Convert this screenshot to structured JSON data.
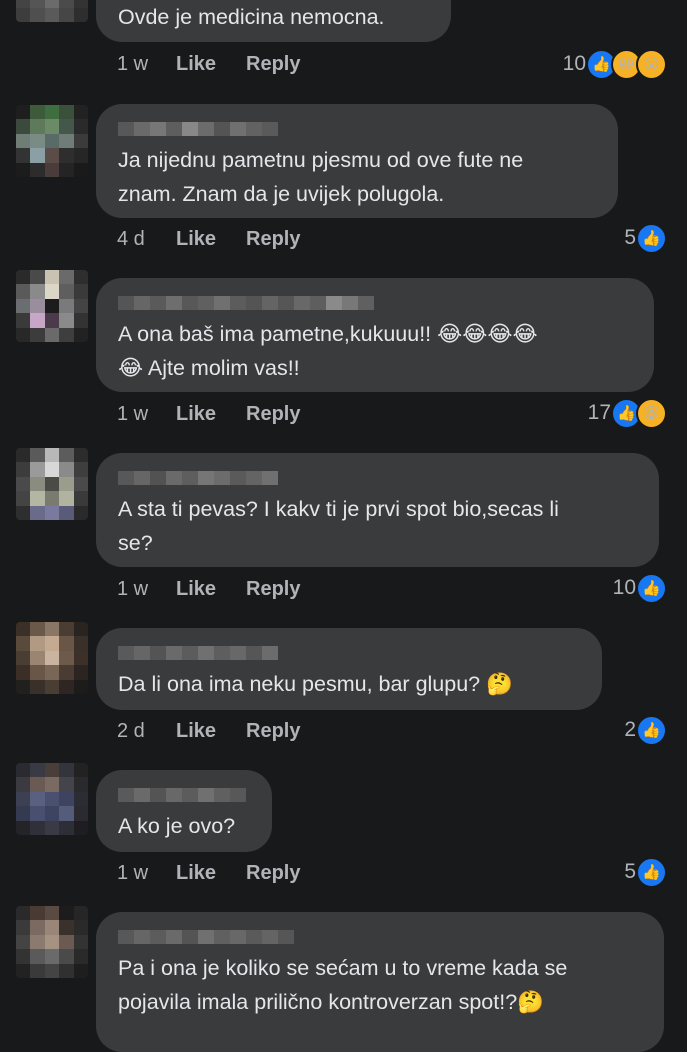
{
  "comments": [
    {
      "text": [
        "Ovde je medicina nemocna."
      ],
      "time": "1 w",
      "like": "Like",
      "reply": "Reply",
      "count": "10",
      "reactions": [
        "like-icon",
        "haha-icon",
        "wow-icon"
      ]
    },
    {
      "text": [
        "Ja nijednu pametnu pjesmu od ove fute ne",
        "znam. Znam da je uvijek polugola."
      ],
      "time": "4 d",
      "like": "Like",
      "reply": "Reply",
      "count": "5",
      "reactions": [
        "like-icon"
      ]
    },
    {
      "text": [
        "A ona baš ima pametne,kukuuu!! 😂😂😂😂",
        "😂 Ajte molim vas!!"
      ],
      "time": "1 w",
      "like": "Like",
      "reply": "Reply",
      "count": "17",
      "reactions": [
        "like-icon",
        "haha-icon"
      ]
    },
    {
      "text": [
        "A sta ti pevas? I kakv ti je prvi spot bio,secas li",
        "se?"
      ],
      "time": "1 w",
      "like": "Like",
      "reply": "Reply",
      "count": "10",
      "reactions": [
        "like-icon"
      ]
    },
    {
      "text": [
        "Da li ona ima neku pesmu, bar glupu? 🤔"
      ],
      "time": "2 d",
      "like": "Like",
      "reply": "Reply",
      "count": "2",
      "reactions": [
        "like-icon"
      ]
    },
    {
      "text": [
        "A ko je ovo?"
      ],
      "time": "1 w",
      "like": "Like",
      "reply": "Reply",
      "count": "5",
      "reactions": [
        "like-icon"
      ]
    },
    {
      "text": [
        "Pa i ona je koliko se sećam u to vreme kada se",
        "pojavila imala prilično kontroverzan spot!?🤔"
      ],
      "time": "",
      "like": "",
      "reply": "",
      "count": "",
      "reactions": []
    }
  ],
  "colors": {
    "background": "#18191a",
    "bubble": "#3a3b3c",
    "text": "#e4e6eb",
    "meta": "#b0b3b8",
    "like_blue": "#1877f2",
    "emoji_yellow": "#f7b125"
  }
}
